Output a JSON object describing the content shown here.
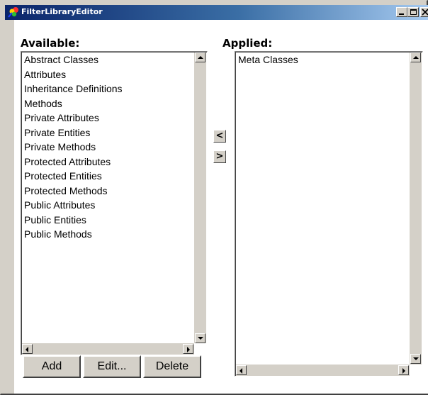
{
  "window": {
    "title": "FilterLibraryEditor",
    "icon": "app-icon",
    "controls": {
      "minimize": "_",
      "maximize": "□",
      "close": "×"
    }
  },
  "available": {
    "label": "Available:",
    "items": [
      "Abstract Classes",
      "Attributes",
      "Inheritance Definitions",
      "Methods",
      "Private Attributes",
      "Private Entities",
      "Private Methods",
      "Protected Attributes",
      "Protected Entities",
      "Protected Methods",
      "Public Attributes",
      "Public Entities",
      "Public Methods"
    ]
  },
  "applied": {
    "label": "Applied:",
    "items": [
      "Meta Classes"
    ]
  },
  "transfer": {
    "move_left": "<",
    "move_right": ">"
  },
  "buttons": {
    "add": "Add",
    "edit": "Edit...",
    "delete": "Delete"
  }
}
